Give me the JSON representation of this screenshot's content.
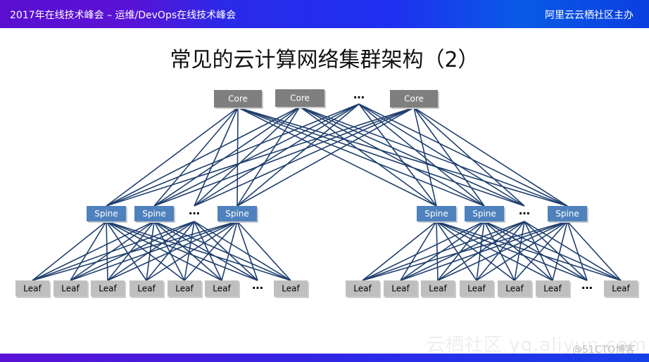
{
  "header": {
    "left": "2017年在线技术峰会 – 运维/DevOps在线技术峰会",
    "right": "阿里云云栖社区主办"
  },
  "title": "常见的云计算网络集群架构（2）",
  "diagram": {
    "core": [
      "Core",
      "Core",
      "…",
      "Core"
    ],
    "spine_left": [
      "Spine",
      "Spine",
      "…",
      "Spine"
    ],
    "spine_right": [
      "Spine",
      "Spine",
      "…",
      "Spine"
    ],
    "leaf_left": [
      "Leaf",
      "Leaf",
      "Leaf",
      "Leaf",
      "Leaf",
      "Leaf",
      "…",
      "Leaf"
    ],
    "leaf_right": [
      "Leaf",
      "Leaf",
      "Leaf",
      "Leaf",
      "Leaf",
      "Leaf",
      "…",
      "Leaf"
    ],
    "colors": {
      "core": "#7f7f7f",
      "spine": "#4f81bd",
      "leaf": "#bfbfbf",
      "link": "#1f3f6f"
    }
  },
  "watermark": {
    "site": "云栖社区 yq.aliyun.com",
    "blog": "@51CTO博客"
  }
}
